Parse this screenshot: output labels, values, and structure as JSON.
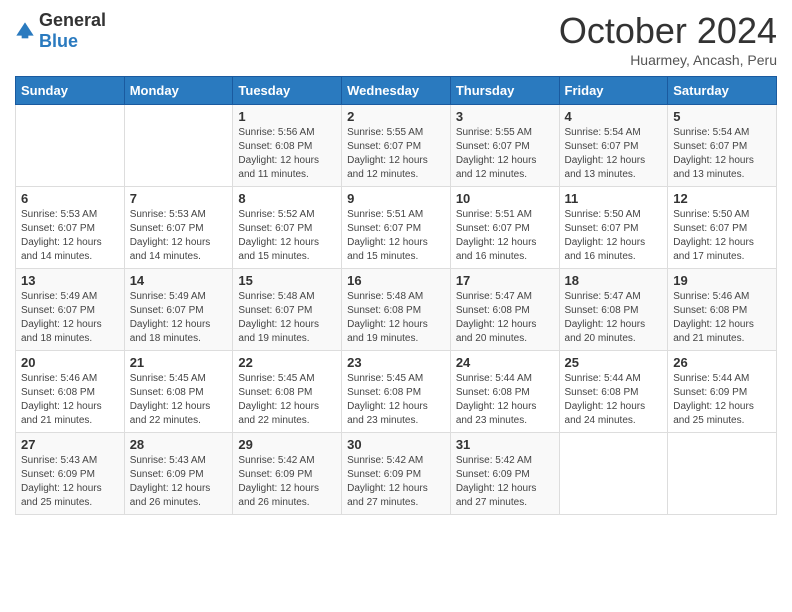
{
  "header": {
    "logo": {
      "general": "General",
      "blue": "Blue"
    },
    "title": "October 2024",
    "subtitle": "Huarmey, Ancash, Peru"
  },
  "calendar": {
    "days_of_week": [
      "Sunday",
      "Monday",
      "Tuesday",
      "Wednesday",
      "Thursday",
      "Friday",
      "Saturday"
    ],
    "weeks": [
      [
        {
          "day": "",
          "info": ""
        },
        {
          "day": "",
          "info": ""
        },
        {
          "day": "1",
          "info": "Sunrise: 5:56 AM\nSunset: 6:08 PM\nDaylight: 12 hours\nand 11 minutes."
        },
        {
          "day": "2",
          "info": "Sunrise: 5:55 AM\nSunset: 6:07 PM\nDaylight: 12 hours\nand 12 minutes."
        },
        {
          "day": "3",
          "info": "Sunrise: 5:55 AM\nSunset: 6:07 PM\nDaylight: 12 hours\nand 12 minutes."
        },
        {
          "day": "4",
          "info": "Sunrise: 5:54 AM\nSunset: 6:07 PM\nDaylight: 12 hours\nand 13 minutes."
        },
        {
          "day": "5",
          "info": "Sunrise: 5:54 AM\nSunset: 6:07 PM\nDaylight: 12 hours\nand 13 minutes."
        }
      ],
      [
        {
          "day": "6",
          "info": "Sunrise: 5:53 AM\nSunset: 6:07 PM\nDaylight: 12 hours\nand 14 minutes."
        },
        {
          "day": "7",
          "info": "Sunrise: 5:53 AM\nSunset: 6:07 PM\nDaylight: 12 hours\nand 14 minutes."
        },
        {
          "day": "8",
          "info": "Sunrise: 5:52 AM\nSunset: 6:07 PM\nDaylight: 12 hours\nand 15 minutes."
        },
        {
          "day": "9",
          "info": "Sunrise: 5:51 AM\nSunset: 6:07 PM\nDaylight: 12 hours\nand 15 minutes."
        },
        {
          "day": "10",
          "info": "Sunrise: 5:51 AM\nSunset: 6:07 PM\nDaylight: 12 hours\nand 16 minutes."
        },
        {
          "day": "11",
          "info": "Sunrise: 5:50 AM\nSunset: 6:07 PM\nDaylight: 12 hours\nand 16 minutes."
        },
        {
          "day": "12",
          "info": "Sunrise: 5:50 AM\nSunset: 6:07 PM\nDaylight: 12 hours\nand 17 minutes."
        }
      ],
      [
        {
          "day": "13",
          "info": "Sunrise: 5:49 AM\nSunset: 6:07 PM\nDaylight: 12 hours\nand 18 minutes."
        },
        {
          "day": "14",
          "info": "Sunrise: 5:49 AM\nSunset: 6:07 PM\nDaylight: 12 hours\nand 18 minutes."
        },
        {
          "day": "15",
          "info": "Sunrise: 5:48 AM\nSunset: 6:07 PM\nDaylight: 12 hours\nand 19 minutes."
        },
        {
          "day": "16",
          "info": "Sunrise: 5:48 AM\nSunset: 6:08 PM\nDaylight: 12 hours\nand 19 minutes."
        },
        {
          "day": "17",
          "info": "Sunrise: 5:47 AM\nSunset: 6:08 PM\nDaylight: 12 hours\nand 20 minutes."
        },
        {
          "day": "18",
          "info": "Sunrise: 5:47 AM\nSunset: 6:08 PM\nDaylight: 12 hours\nand 20 minutes."
        },
        {
          "day": "19",
          "info": "Sunrise: 5:46 AM\nSunset: 6:08 PM\nDaylight: 12 hours\nand 21 minutes."
        }
      ],
      [
        {
          "day": "20",
          "info": "Sunrise: 5:46 AM\nSunset: 6:08 PM\nDaylight: 12 hours\nand 21 minutes."
        },
        {
          "day": "21",
          "info": "Sunrise: 5:45 AM\nSunset: 6:08 PM\nDaylight: 12 hours\nand 22 minutes."
        },
        {
          "day": "22",
          "info": "Sunrise: 5:45 AM\nSunset: 6:08 PM\nDaylight: 12 hours\nand 22 minutes."
        },
        {
          "day": "23",
          "info": "Sunrise: 5:45 AM\nSunset: 6:08 PM\nDaylight: 12 hours\nand 23 minutes."
        },
        {
          "day": "24",
          "info": "Sunrise: 5:44 AM\nSunset: 6:08 PM\nDaylight: 12 hours\nand 23 minutes."
        },
        {
          "day": "25",
          "info": "Sunrise: 5:44 AM\nSunset: 6:08 PM\nDaylight: 12 hours\nand 24 minutes."
        },
        {
          "day": "26",
          "info": "Sunrise: 5:44 AM\nSunset: 6:09 PM\nDaylight: 12 hours\nand 25 minutes."
        }
      ],
      [
        {
          "day": "27",
          "info": "Sunrise: 5:43 AM\nSunset: 6:09 PM\nDaylight: 12 hours\nand 25 minutes."
        },
        {
          "day": "28",
          "info": "Sunrise: 5:43 AM\nSunset: 6:09 PM\nDaylight: 12 hours\nand 26 minutes."
        },
        {
          "day": "29",
          "info": "Sunrise: 5:42 AM\nSunset: 6:09 PM\nDaylight: 12 hours\nand 26 minutes."
        },
        {
          "day": "30",
          "info": "Sunrise: 5:42 AM\nSunset: 6:09 PM\nDaylight: 12 hours\nand 27 minutes."
        },
        {
          "day": "31",
          "info": "Sunrise: 5:42 AM\nSunset: 6:09 PM\nDaylight: 12 hours\nand 27 minutes."
        },
        {
          "day": "",
          "info": ""
        },
        {
          "day": "",
          "info": ""
        }
      ]
    ]
  }
}
